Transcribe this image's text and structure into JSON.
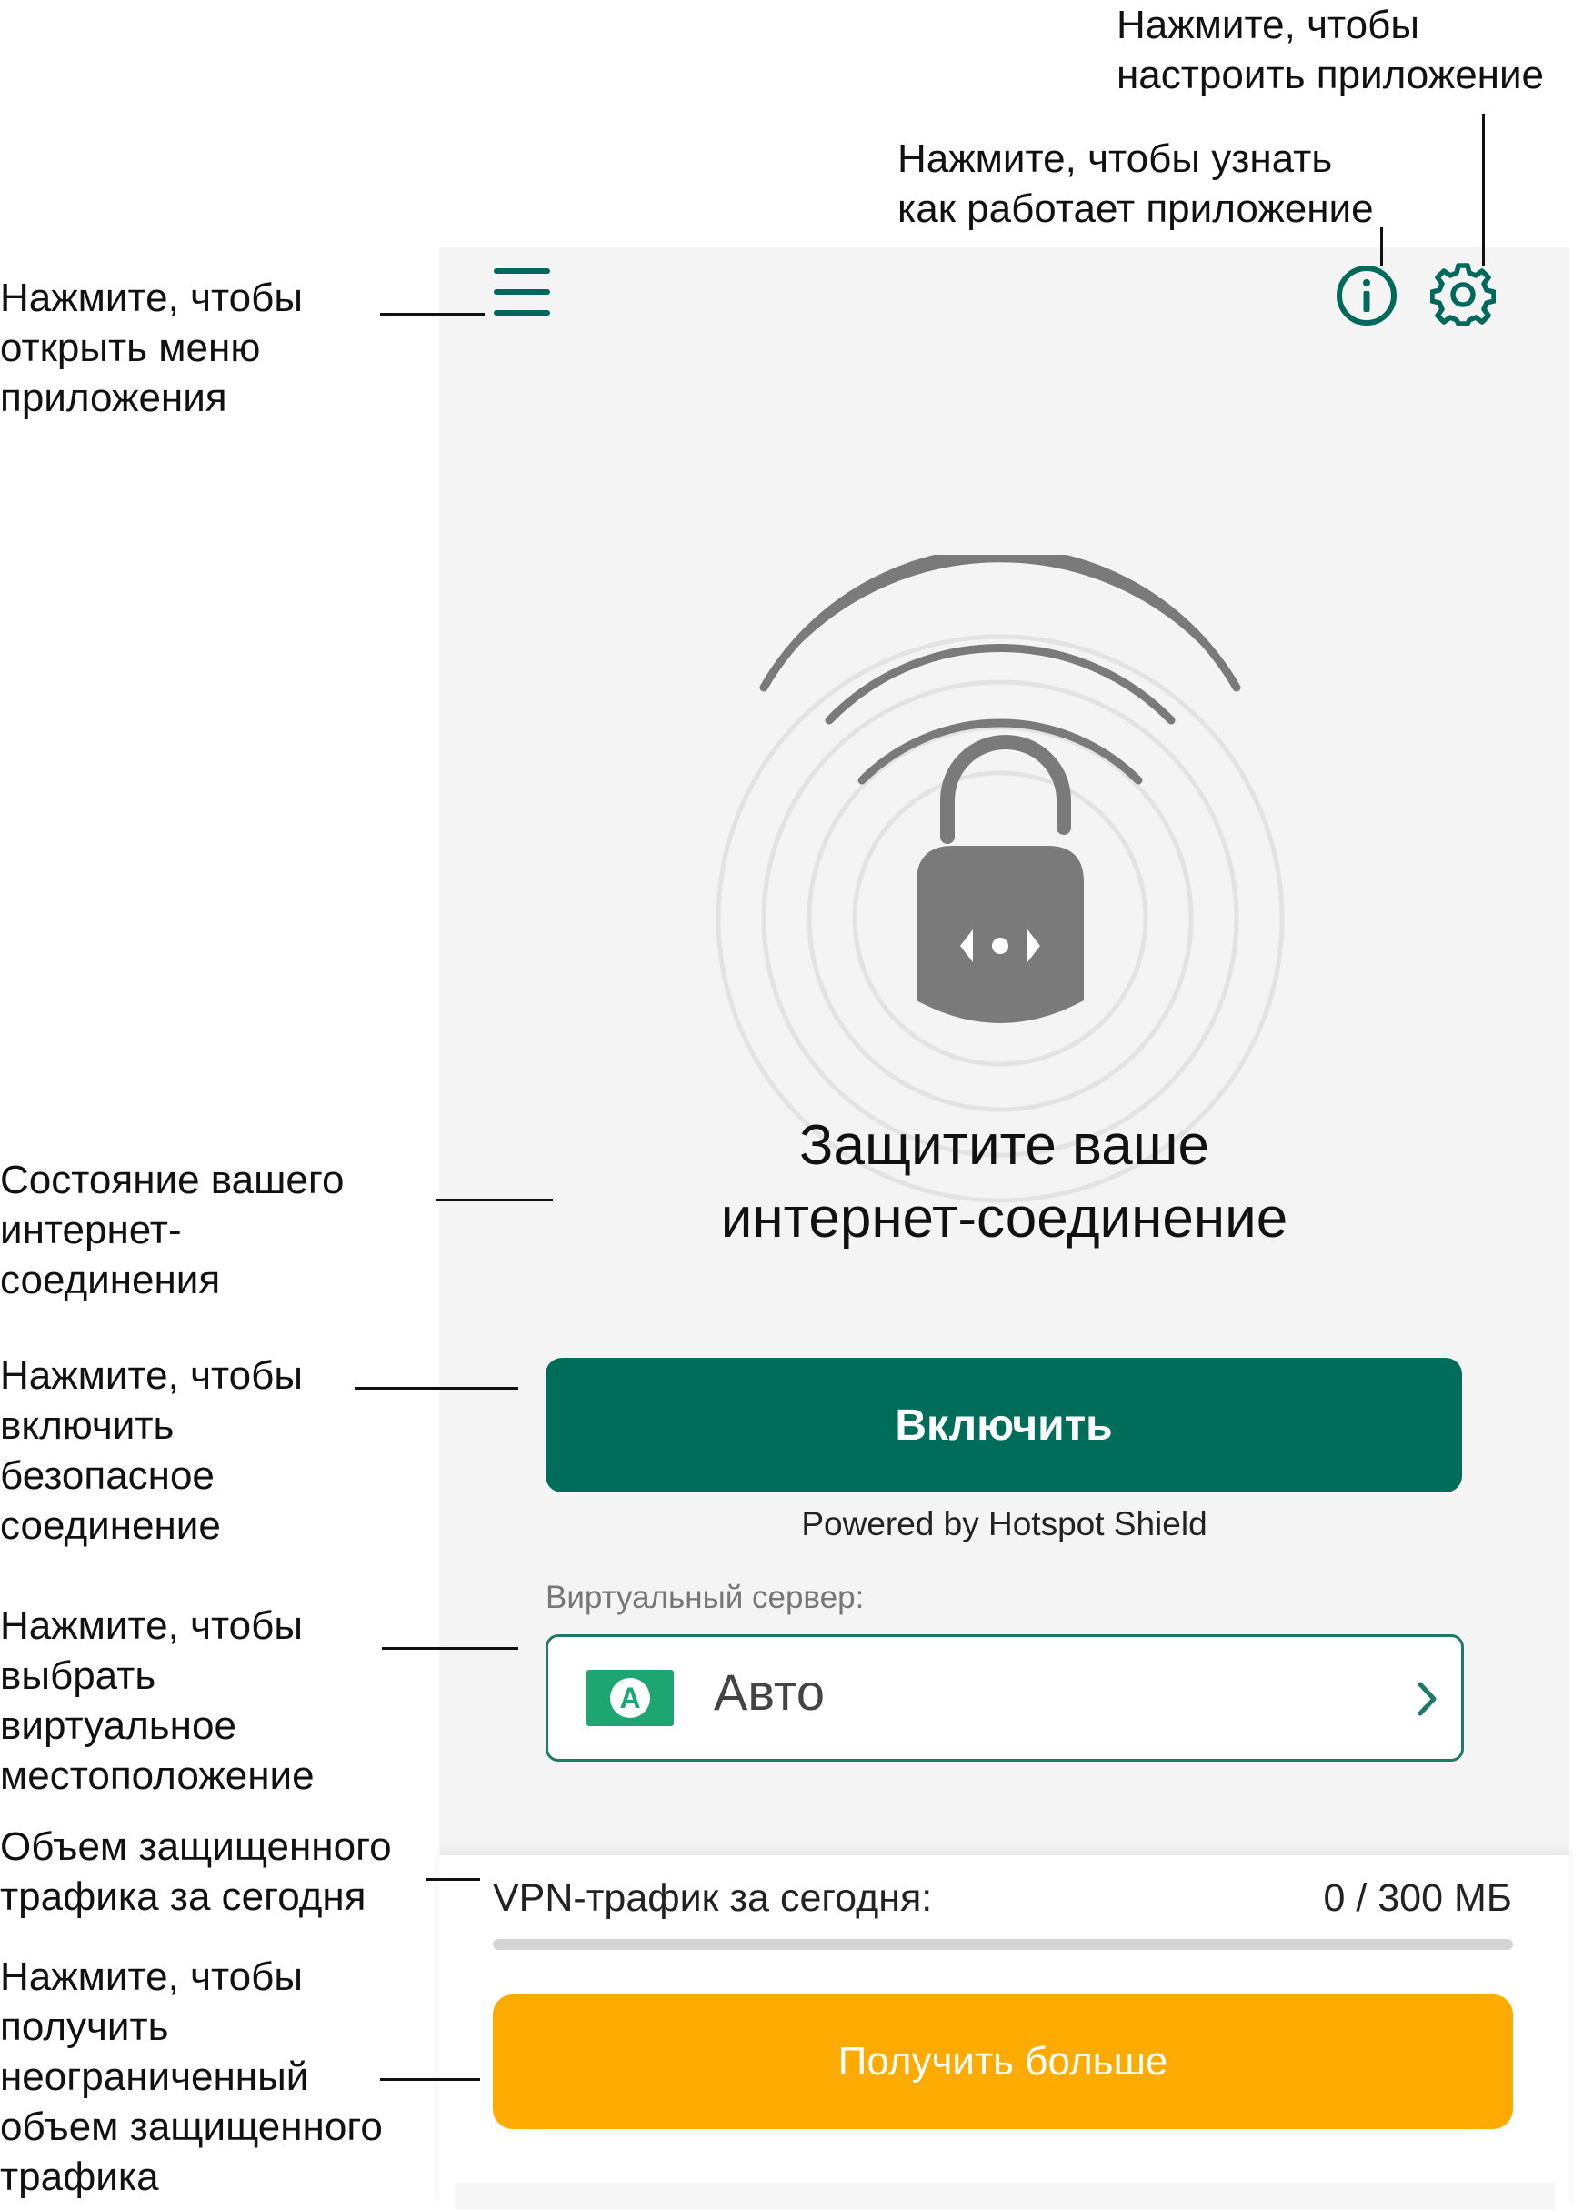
{
  "callouts": {
    "settings": "Нажмите, чтобы\nнастроить приложение",
    "info": "Нажмите, чтобы узнать\nкак работает приложение",
    "menu": "Нажмите, чтобы\nоткрыть меню\nприложения",
    "status": "Состояние вашего\nинтернет-\nсоединения",
    "enable": "Нажмите, чтобы\nвключить\nбезопасное\nсоединение",
    "server": "Нажмите, чтобы\nвыбрать\nвиртуальное\nместоположение",
    "traffic": "Объем защищенного\nтрафика за сегодня",
    "more": "Нажмите, чтобы\nполучить\nнеограниченный\nобъем защищенного\nтрафика"
  },
  "app": {
    "status_title": "Защитите ваше\nинтернет-соединение",
    "enable_label": "Включить",
    "powered_by": "Powered by Hotspot Shield",
    "server_label": "Виртуальный сервер:",
    "server_badge": "A",
    "server_value": "Авто",
    "traffic_label": "VPN-трафик за сегодня:",
    "traffic_value": "0 / 300 МБ",
    "traffic_used_fraction": 0,
    "more_label": "Получить больше"
  },
  "colors": {
    "accent": "#006d5b",
    "warning": "#fdab00",
    "badge": "#1ea672",
    "lock": "#7a7a7a"
  },
  "icons": [
    "menu-icon",
    "info-icon",
    "gear-icon",
    "unlocked-padlock-icon",
    "chevron-right-icon"
  ]
}
